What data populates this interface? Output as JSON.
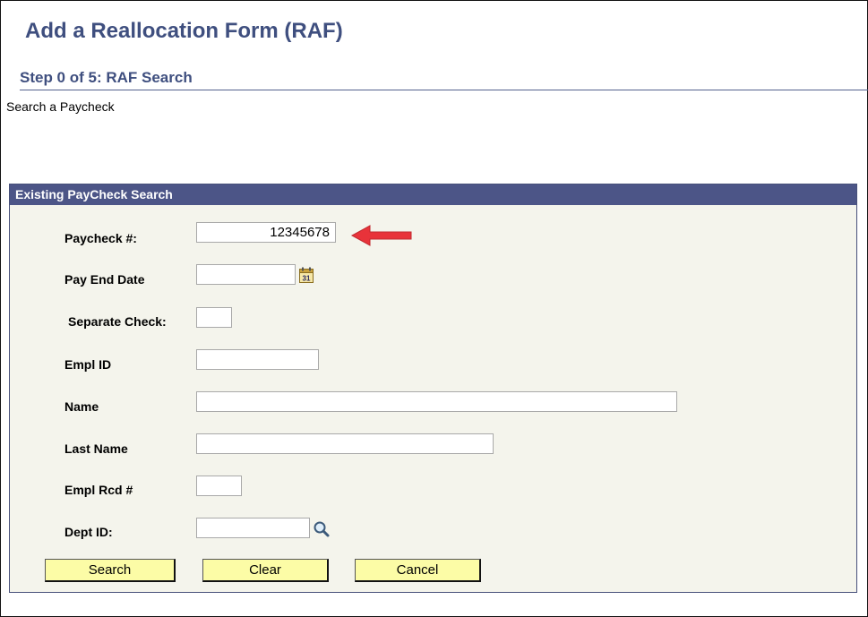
{
  "page": {
    "title": "Add a Reallocation Form (RAF)",
    "step": "Step 0 of 5: RAF Search",
    "subtitle": "Search a Paycheck"
  },
  "search_group": {
    "header": "Existing PayCheck Search",
    "fields": {
      "paycheck": {
        "label": "Paycheck #:",
        "value": "12345678"
      },
      "pay_end_date": {
        "label": "Pay End Date",
        "value": "",
        "icon": "calendar-icon",
        "icon_text": "31"
      },
      "separate_check": {
        "label": "Separate Check:",
        "value": ""
      },
      "empl_id": {
        "label": "Empl ID",
        "value": ""
      },
      "name": {
        "label": "Name",
        "value": ""
      },
      "last_name": {
        "label": "Last Name",
        "value": ""
      },
      "empl_rcd": {
        "label": "Empl Rcd #",
        "value": ""
      },
      "dept_id": {
        "label": "Dept ID:",
        "value": "",
        "icon": "lookup-magnifier-icon"
      }
    },
    "buttons": {
      "search": "Search",
      "clear": "Clear",
      "cancel": "Cancel"
    }
  },
  "annotation": {
    "icon": "red-arrow-icon",
    "color": "#e8333a"
  },
  "colors": {
    "title": "#3f4f7f",
    "group_header_bg": "#4c5587",
    "group_bg": "#f4f4ec",
    "button_bg": "#fcfca6"
  }
}
